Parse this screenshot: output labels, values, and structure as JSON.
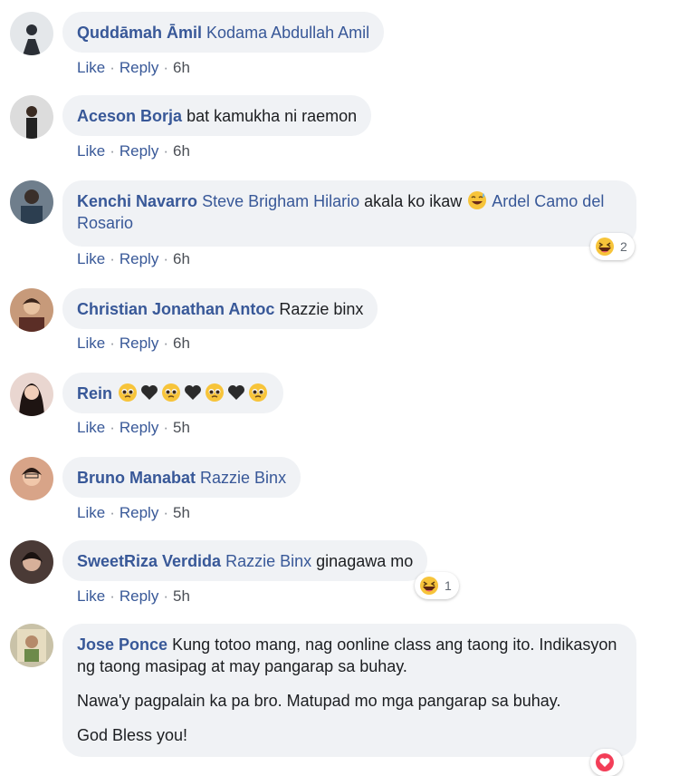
{
  "comments": [
    {
      "author": "Quddāmah Āmil",
      "mention": "Kodama Abdullah Amil",
      "text": "",
      "time": "6h"
    },
    {
      "author": "Aceson Borja",
      "text": "bat kamukha ni raemon",
      "time": "6h"
    },
    {
      "author": "Kenchi Navarro",
      "mention": "Steve Brigham Hilario",
      "text": "akala ko ikaw",
      "mention2": "Ardel Camo del Rosario",
      "time": "6h",
      "reaction_count": "2",
      "reaction_icon": "haha-emoji"
    },
    {
      "author": "Christian Jonathan Antoc",
      "text": "Razzie binx",
      "time": "6h"
    },
    {
      "author": "Rein",
      "time": "5h",
      "emoji_sequence": [
        "pleading-face",
        "black-heart",
        "pleading-face",
        "black-heart",
        "pleading-face",
        "black-heart",
        "pleading-face"
      ]
    },
    {
      "author": "Bruno Manabat",
      "mention": "Razzie Binx",
      "time": "5h"
    },
    {
      "author": "SweetRiza Verdida",
      "mention": "Razzie Binx",
      "text": "ginagawa mo",
      "time": "5h",
      "reaction_count": "1",
      "reaction_icon": "haha-emoji"
    },
    {
      "author": "Jose Ponce",
      "paragraphs": [
        "Kung totoo mang, nag oonline class ang taong ito. Indikasyon ng taong masipag at may pangarap sa buhay.",
        "Nawa'y pagpalain ka pa bro. Matupad mo mga pangarap sa buhay.",
        "God Bless you!"
      ],
      "reaction_icon": "love-emoji"
    }
  ],
  "actions": {
    "like": "Like",
    "reply": "Reply",
    "separator": "·"
  },
  "colors": {
    "link": "#385898",
    "bubble": "#f0f2f5",
    "meta": "#4b4f56"
  }
}
